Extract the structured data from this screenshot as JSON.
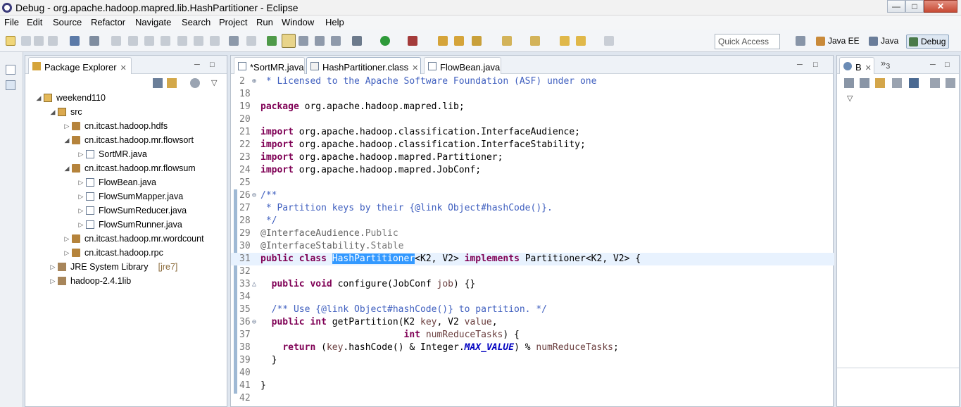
{
  "window": {
    "title": "Debug - org.apache.hadoop.mapred.lib.HashPartitioner - Eclipse"
  },
  "menu": [
    "File",
    "Edit",
    "Source",
    "Refactor",
    "Navigate",
    "Search",
    "Project",
    "Run",
    "Window",
    "Help"
  ],
  "toolbar": {
    "quick_access_placeholder": "Quick Access",
    "perspectives": [
      "Java EE",
      "Java",
      "Debug"
    ]
  },
  "package_explorer": {
    "title": "Package Explorer",
    "items": [
      {
        "label": "weekend110",
        "suffix": "",
        "level": 0,
        "type": "project",
        "expanded": true
      },
      {
        "label": "src",
        "suffix": "",
        "level": 1,
        "type": "src",
        "expanded": true
      },
      {
        "label": "cn.itcast.hadoop.hdfs",
        "suffix": "",
        "level": 2,
        "type": "package",
        "expanded": false
      },
      {
        "label": "cn.itcast.hadoop.mr.flowsort",
        "suffix": "",
        "level": 2,
        "type": "package",
        "expanded": true
      },
      {
        "label": "SortMR.java",
        "suffix": "",
        "level": 3,
        "type": "file",
        "expanded": false
      },
      {
        "label": "cn.itcast.hadoop.mr.flowsum",
        "suffix": "",
        "level": 2,
        "type": "package",
        "expanded": true
      },
      {
        "label": "FlowBean.java",
        "suffix": "",
        "level": 3,
        "type": "file",
        "expanded": false
      },
      {
        "label": "FlowSumMapper.java",
        "suffix": "",
        "level": 3,
        "type": "file",
        "expanded": false
      },
      {
        "label": "FlowSumReducer.java",
        "suffix": "",
        "level": 3,
        "type": "file",
        "expanded": false
      },
      {
        "label": "FlowSumRunner.java",
        "suffix": "",
        "level": 3,
        "type": "file",
        "expanded": false
      },
      {
        "label": "cn.itcast.hadoop.mr.wordcount",
        "suffix": "",
        "level": 2,
        "type": "package",
        "expanded": false
      },
      {
        "label": "cn.itcast.hadoop.rpc",
        "suffix": "",
        "level": 2,
        "type": "package",
        "expanded": false
      },
      {
        "label": "JRE System Library",
        "suffix": "[jre7]",
        "level": 1,
        "type": "lib",
        "expanded": false
      },
      {
        "label": "hadoop-2.4.1lib",
        "suffix": "",
        "level": 1,
        "type": "lib",
        "expanded": false
      }
    ]
  },
  "editor": {
    "tabs": [
      {
        "label": "*SortMR.java",
        "active": false
      },
      {
        "label": "HashPartitioner.class",
        "active": true
      },
      {
        "label": "FlowBean.java",
        "active": false
      }
    ],
    "lines": [
      {
        "n": "2",
        "text": " * Licensed to the Apache Software Foundation (ASF) under one"
      },
      {
        "n": "18",
        "text": ""
      },
      {
        "n": "19",
        "text": "package org.apache.hadoop.mapred.lib;"
      },
      {
        "n": "20",
        "text": ""
      },
      {
        "n": "21",
        "text": "import org.apache.hadoop.classification.InterfaceAudience;"
      },
      {
        "n": "22",
        "text": "import org.apache.hadoop.classification.InterfaceStability;"
      },
      {
        "n": "23",
        "text": "import org.apache.hadoop.mapred.Partitioner;"
      },
      {
        "n": "24",
        "text": "import org.apache.hadoop.mapred.JobConf;"
      },
      {
        "n": "25",
        "text": ""
      },
      {
        "n": "26",
        "text": "/**"
      },
      {
        "n": "27",
        "text": " * Partition keys by their {@link Object#hashCode()}."
      },
      {
        "n": "28",
        "text": " */"
      },
      {
        "n": "29",
        "text": "@InterfaceAudience.Public"
      },
      {
        "n": "30",
        "text": "@InterfaceStability.Stable"
      },
      {
        "n": "31",
        "text": "public class HashPartitioner<K2, V2> implements Partitioner<K2, V2> {"
      },
      {
        "n": "32",
        "text": ""
      },
      {
        "n": "33",
        "text": "  public void configure(JobConf job) {}"
      },
      {
        "n": "34",
        "text": ""
      },
      {
        "n": "35",
        "text": "  /** Use {@link Object#hashCode()} to partition. */"
      },
      {
        "n": "36",
        "text": "  public int getPartition(K2 key, V2 value,"
      },
      {
        "n": "37",
        "text": "                          int numReduceTasks) {"
      },
      {
        "n": "38",
        "text": "    return (key.hashCode() & Integer.MAX_VALUE) % numReduceTasks;"
      },
      {
        "n": "39",
        "text": "  }"
      },
      {
        "n": "40",
        "text": ""
      },
      {
        "n": "41",
        "text": "}"
      },
      {
        "n": "42",
        "text": ""
      }
    ],
    "selected_text": "HashPartitioner",
    "current_line": "31"
  },
  "right_panel": {
    "tab_label": "B",
    "overflow_label": "»",
    "overflow_count": "3"
  },
  "colors": {
    "keyword": "#7f0055",
    "comment": "#3f5fbf",
    "selection": "#3399ff",
    "current_line": "#e8f2fe"
  }
}
